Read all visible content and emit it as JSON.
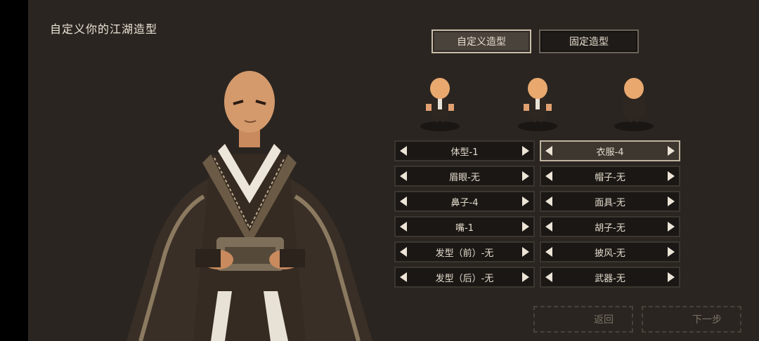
{
  "title": "自定义你的江湖造型",
  "tabs": [
    {
      "label": "自定义造型",
      "active": true
    },
    {
      "label": "固定造型",
      "active": false
    }
  ],
  "options": {
    "left": [
      {
        "label": "体型-1"
      },
      {
        "label": "眉眼-无"
      },
      {
        "label": "鼻子-4"
      },
      {
        "label": "嘴-1"
      },
      {
        "label": "发型（前）-无"
      },
      {
        "label": "发型（后）-无"
      }
    ],
    "right": [
      {
        "label": "衣服-4",
        "selected": true
      },
      {
        "label": "帽子-无"
      },
      {
        "label": "面具-无"
      },
      {
        "label": "胡子-无"
      },
      {
        "label": "披风-无"
      },
      {
        "label": "武器-无"
      }
    ]
  },
  "buttons": {
    "back": "返回",
    "next": "下一步"
  },
  "colors": {
    "panel_bg": "#2a2521",
    "option_bg": "#1b1715",
    "selected_border": "#c0b49f",
    "text": "#e6ddce"
  }
}
